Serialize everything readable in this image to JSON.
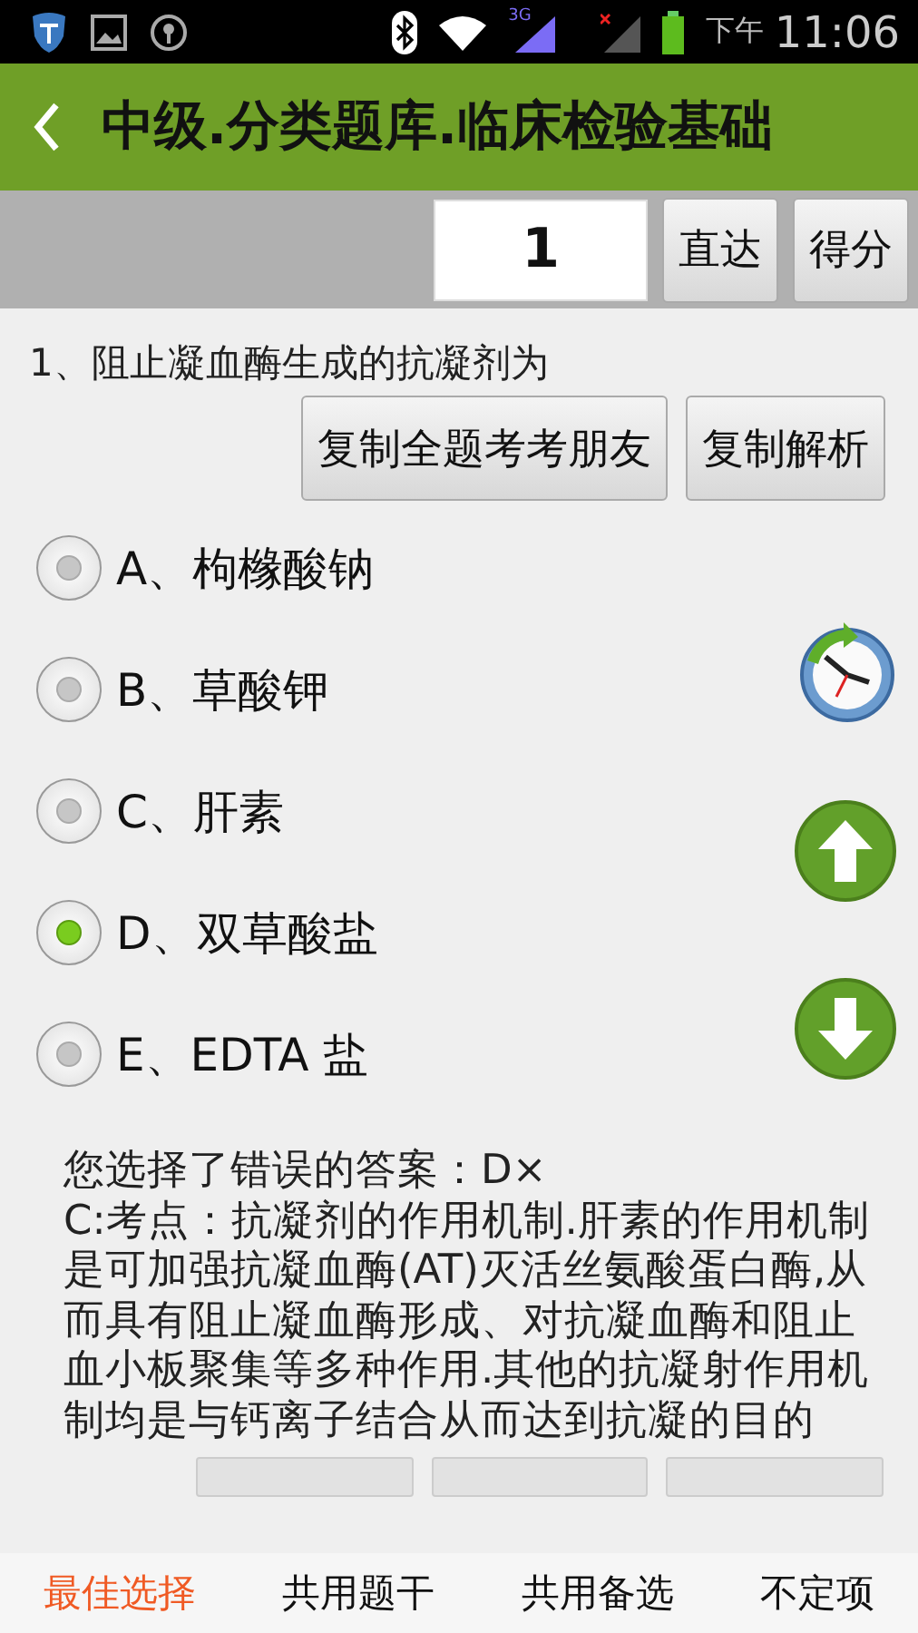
{
  "status_bar": {
    "network": "3G",
    "period": "下午",
    "time": "11:06"
  },
  "title_bar": {
    "title": "中级.分类题库.临床检验基础"
  },
  "toolbar": {
    "question_number": "1",
    "buttons": [
      "直达",
      "得分"
    ]
  },
  "question": {
    "text": "1、阻止凝血酶生成的抗凝剂为",
    "buttons": [
      "复制全题考考朋友",
      "复制解析"
    ]
  },
  "options": [
    {
      "label": "A、枸橼酸钠",
      "selected": false
    },
    {
      "label": "B、草酸钾",
      "selected": false
    },
    {
      "label": "C、肝素",
      "selected": false
    },
    {
      "label": "D、双草酸盐",
      "selected": true
    },
    {
      "label": "E、EDTA 盐",
      "selected": false
    }
  ],
  "side_buttons": [
    {
      "kind": "clock"
    },
    {
      "kind": "up"
    },
    {
      "kind": "down"
    }
  ],
  "result": "您选择了错误的答案：D×",
  "explanation": "C:考点：抗凝剂的作用机制.肝素的作用机制是可加强抗凝血酶(AT)灭活丝氨酸蛋白酶,从而具有阻止凝血酶形成、对抗凝血酶和阻止血小板聚集等多种作用.其他的抗凝射作用机制均是与钙离子结合从而达到抗凝的目的",
  "bottom_tabs": [
    {
      "label": "最佳选择",
      "selected": true
    },
    {
      "label": "共用题干",
      "selected": false
    },
    {
      "label": "共用备选",
      "selected": false
    },
    {
      "label": "不定项",
      "selected": false
    }
  ]
}
